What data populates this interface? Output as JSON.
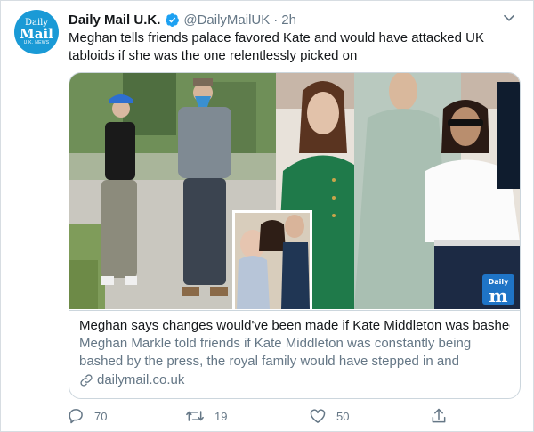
{
  "account": {
    "avatar_line1": "Daily",
    "avatar_line2": "Mail",
    "avatar_line3": "U.K. NEWS",
    "name": "Daily Mail U.K.",
    "handle": "@DailyMailUK",
    "separator": "·",
    "time": "2h",
    "verified": true
  },
  "tweet": {
    "text": "Meghan tells friends palace favored Kate and would have attacked UK tabloids if she was the one relentlessly picked on"
  },
  "card": {
    "watermark_line1": "Daily",
    "watermark_line2": "m",
    "title": "Meghan says changes would've been made if Kate Middleton was bashed",
    "description": "Meghan Markle told friends if Kate Middleton was constantly being bashed by the press, the royal family would have stepped in and chang...",
    "domain": "dailymail.co.uk"
  },
  "actions": {
    "replies": "70",
    "retweets": "19",
    "likes": "50"
  },
  "colors": {
    "brand_blue": "#1a9ad6",
    "verified_blue": "#1da1f2",
    "text_primary": "#14171a",
    "text_secondary": "#657786",
    "border": "#ccd6dd"
  },
  "icons": {
    "verified": "verified-badge-icon",
    "caret": "chevron-down-icon",
    "link": "link-icon",
    "reply": "reply-icon",
    "retweet": "retweet-icon",
    "like": "heart-icon",
    "share": "share-icon"
  }
}
